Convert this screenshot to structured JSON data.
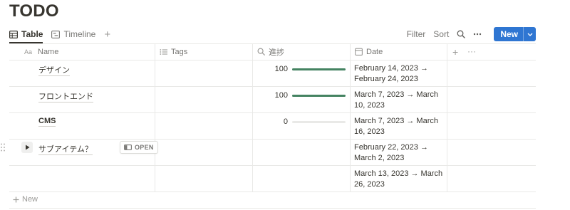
{
  "page": {
    "title": "TODO"
  },
  "views": {
    "tabs": [
      {
        "label": "Table",
        "icon": "table-icon"
      },
      {
        "label": "Timeline",
        "icon": "timeline-icon"
      }
    ],
    "add_label": "+"
  },
  "toolbar": {
    "filter_label": "Filter",
    "sort_label": "Sort",
    "new_label": "New"
  },
  "columns": [
    {
      "label": "Name",
      "icon": "text-icon"
    },
    {
      "label": "Tags",
      "icon": "list-icon"
    },
    {
      "label": "進捗",
      "icon": "search-icon"
    },
    {
      "label": "Date",
      "icon": "calendar-icon"
    }
  ],
  "rows": [
    {
      "name": "デザイン",
      "progress": 100,
      "progress_label": "100",
      "date": "February 14, 2023 → February 24, 2023"
    },
    {
      "name": "フロントエンド",
      "progress": 100,
      "progress_label": "100",
      "date": "March 7, 2023 → March 10, 2023"
    },
    {
      "name": "CMS",
      "progress": 0,
      "progress_label": "0",
      "date": "March 7, 2023 → March 16, 2023"
    },
    {
      "name": "サブアイテム？",
      "open_label": "OPEN",
      "date": "February 22, 2023 → March 2, 2023"
    },
    {
      "name": "",
      "date": "March 13, 2023 → March 26, 2023"
    }
  ],
  "footer": {
    "new_label": "New"
  },
  "colors": {
    "accent": "#2f76d2",
    "progress": "#448361",
    "border": "#e9e9e7"
  }
}
